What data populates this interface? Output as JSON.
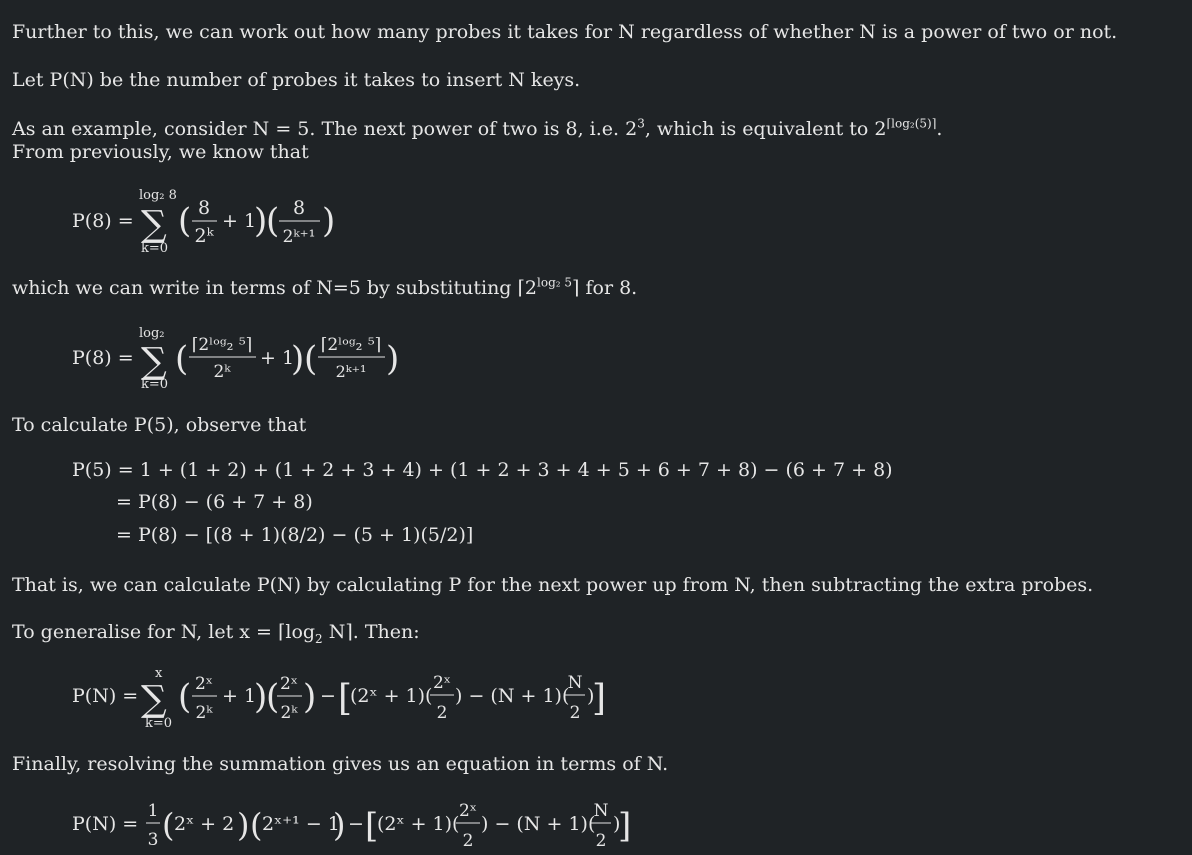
{
  "paragraphs": {
    "p1": "Further to this, we can work out how many probes it takes for N regardless of whether N is a power of two or not.",
    "p2": "Let P(N) be the number of probes it takes to insert N keys.",
    "p3a": "As an example, consider N = 5. The next power of two is 8, i.e. 2",
    "p3_exp": "3",
    "p3b": ", which is equivalent to 2",
    "p3_exp2": "⌈log₂(5)⌉",
    "p3c": ".",
    "p4": "From previously, we know that",
    "p5a": "which we can write in terms of N=5 by substituting ⌈2",
    "p5_exp": "log₂ 5",
    "p5b": "⌉ for 8.",
    "p6": "To calculate P(5), observe that",
    "p7": "That is, we can calculate P(N) by calculating P for the next power up from N, then subtracting the extra probes.",
    "p8a": "To generalise for N, let x = ⌈log",
    "p8_sub": "2",
    "p8b": " N⌉. Then:",
    "p9": "Finally, resolving the summation gives us an equation in terms of N."
  },
  "equations": {
    "eq1": {
      "lhs": "P(8) =",
      "sum_top": "log₂ 8",
      "sum_bottom": "k=0",
      "f1_num": "8",
      "f1_den": "2ᵏ",
      "plus1": "+ 1",
      "f2_num": "8",
      "f2_den": "2ᵏ⁺¹"
    },
    "eq2": {
      "lhs": "P(8) =",
      "sum_top": "log₂",
      "sum_bottom": "k=0",
      "f1_num": "⌈2ˡᵒᵍ₂ ⁵⌉",
      "f1_den": "2ᵏ",
      "plus1": "+ 1",
      "f2_num": "⌈2ˡᵒᵍ₂ ⁵⌉",
      "f2_den": "2ᵏ⁺¹"
    },
    "eq3": {
      "line1": "P(5) = 1 + (1 + 2) + (1 + 2 + 3 + 4) + (1 + 2 + 3 + 4 + 5 + 6 + 7 + 8) − (6 + 7 + 8)",
      "line2": "= P(8) − (6 + 7 + 8)",
      "line3": "= P(8) − [(8 + 1)(8/2) − (5 + 1)(5/2)]"
    },
    "eq4": {
      "lhs": "P(N) =",
      "sum_top": "x",
      "sum_bottom": "k=0",
      "f1_num": "2ˣ",
      "f1_den": "2ᵏ",
      "plus1": "+ 1",
      "f2_num": "2ˣ",
      "f2_den": "2ᵏ",
      "minus": "−",
      "br_a": "(2ˣ + 1)(",
      "br_f1_num": "2ˣ",
      "br_f1_den": "2",
      "br_b": ") − (N + 1)(",
      "br_f2_num": "N",
      "br_f2_den": "2",
      "br_c": ")"
    },
    "eq5": {
      "lhs": "P(N) =",
      "frac_num": "1",
      "frac_den": "3",
      "g1": "2ˣ + 2",
      "g2": "2ˣ⁺¹ − 1",
      "minus": "−",
      "br_a": "(2ˣ + 1)(",
      "br_f1_num": "2ˣ",
      "br_f1_den": "2",
      "br_b": ") − (N + 1)(",
      "br_f2_num": "N",
      "br_f2_den": "2",
      "br_c": ")"
    }
  },
  "colors": {
    "background": "#1f2326",
    "text": "#e6e6e6"
  }
}
